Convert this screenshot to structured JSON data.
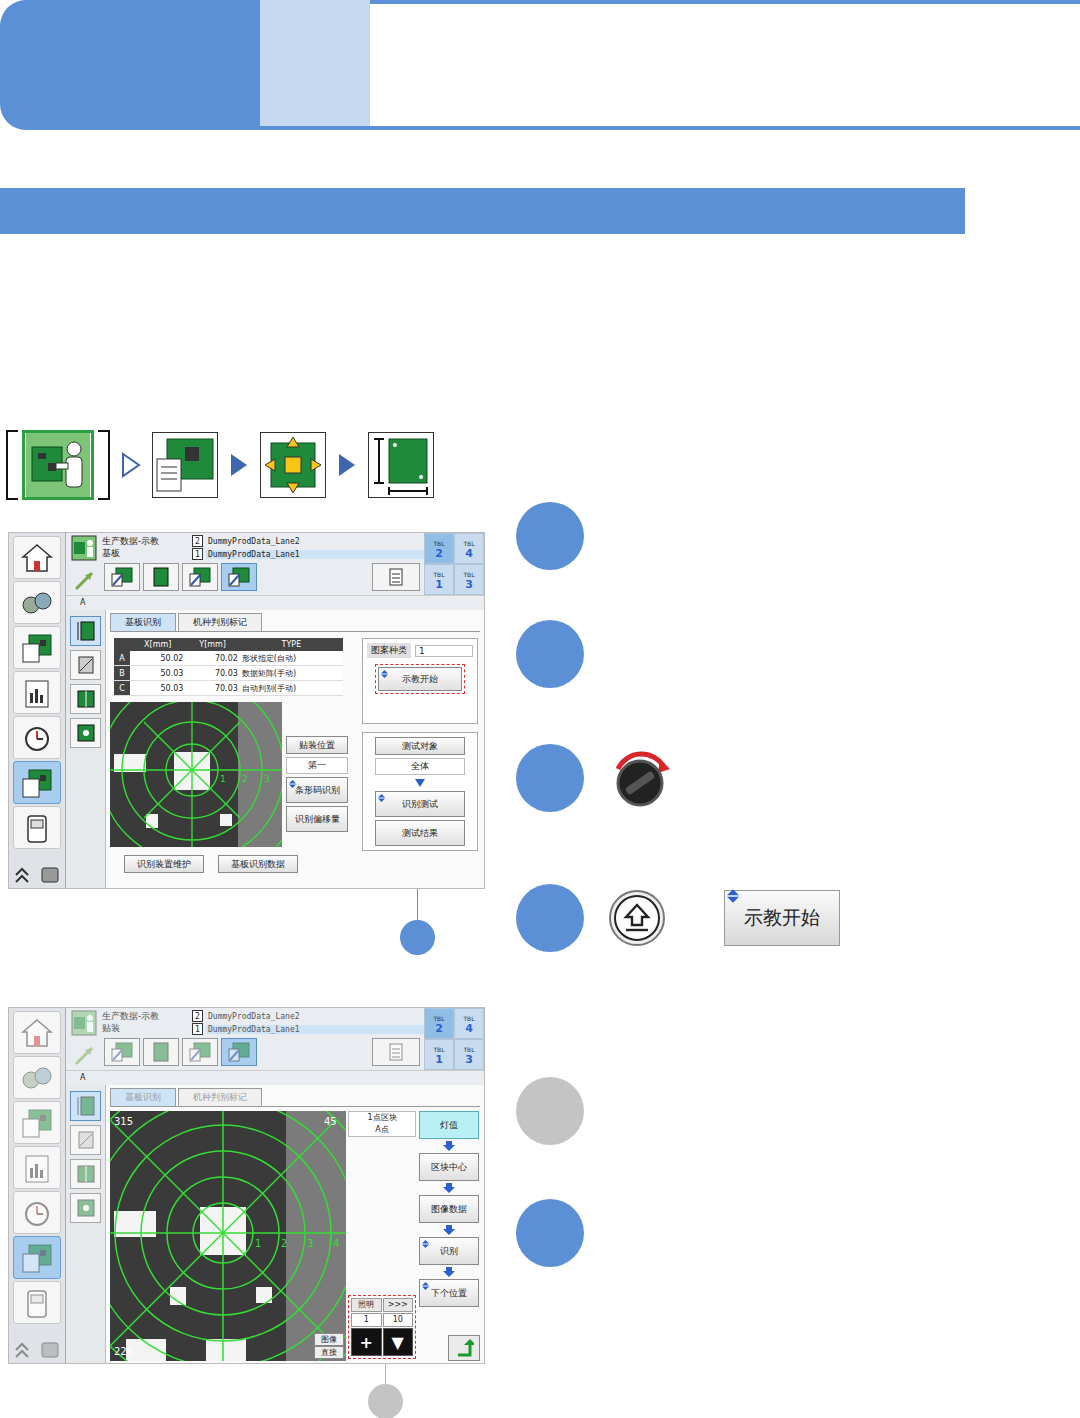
{
  "steps": [
    {
      "kind": "plain",
      "active": true
    },
    {
      "kind": "plain",
      "active": true
    },
    {
      "kind": "knob",
      "active": true
    },
    {
      "kind": "button",
      "active": true,
      "button_label": "示教开始"
    },
    {
      "kind": "plain",
      "active": false
    },
    {
      "kind": "plain",
      "active": true
    }
  ],
  "screens": [
    {
      "kind": "board",
      "dimmed": false,
      "title": "生产数据-示教",
      "subtitle": "基板",
      "lanes": [
        {
          "num": "2",
          "name": "DummyProdData_Lane2",
          "selected": false
        },
        {
          "num": "1",
          "name": "DummyProdData_Lane1",
          "selected": true
        }
      ],
      "tbl": [
        {
          "label": "TBL",
          "num": "2",
          "selected": true
        },
        {
          "label": "TBL",
          "num": "4",
          "selected": false
        },
        {
          "label": "TBL",
          "num": "1",
          "selected": false
        },
        {
          "label": "TBL",
          "num": "3",
          "selected": false
        }
      ],
      "sidebar": [
        {
          "selected": false
        },
        {
          "selected": false
        },
        {
          "selected": false
        },
        {
          "selected": false
        },
        {
          "selected": false
        },
        {
          "selected": true
        },
        {
          "selected": false
        }
      ],
      "toolbar": [
        {
          "selected": false
        },
        {
          "selected": false
        },
        {
          "selected": false
        },
        {
          "selected": true
        }
      ],
      "subside": [
        {
          "selected": true
        },
        {
          "selected": false
        },
        {
          "selected": false
        },
        {
          "selected": false
        }
      ],
      "head_label": "A",
      "tabs": [
        {
          "label": "基板识别",
          "selected": true
        },
        {
          "label": "机种判别标记",
          "selected": false
        }
      ],
      "table": {
        "columns": [
          "X[mm]",
          "Y[mm]",
          "TYPE"
        ],
        "rows": [
          {
            "id": "A",
            "x": "50.02",
            "y": "70.02",
            "type": "形状指定(自动)"
          },
          {
            "id": "B",
            "x": "50.03",
            "y": "70.03",
            "type": "数据矩阵(手动)"
          },
          {
            "id": "C",
            "x": "50.03",
            "y": "70.03",
            "type": "自动判别(手动)"
          }
        ]
      },
      "pattern": {
        "label": "图案种类",
        "value": "1"
      },
      "teach_button": "示教开始",
      "test_target": {
        "label": "测试对象",
        "value": "全体"
      },
      "test_buttons": [
        "识别测试",
        "测试结果"
      ],
      "mount": {
        "label": "贴装位置",
        "value": "第一"
      },
      "side_buttons": [
        "条形码识别",
        "识别偏移量"
      ],
      "bottom_buttons": [
        "识别装置维护",
        "基板识别数据"
      ],
      "rings": [
        "1",
        "2",
        "3"
      ],
      "callout_active": true
    },
    {
      "kind": "teach",
      "dimmed": true,
      "title": "生产数据-示教",
      "subtitle": "贴装",
      "lanes": [
        {
          "num": "2",
          "name": "DummyProdData_Lane2",
          "selected": false
        },
        {
          "num": "1",
          "name": "DummyProdData_Lane1",
          "selected": true
        }
      ],
      "tbl": [
        {
          "label": "TBL",
          "num": "2",
          "selected": true
        },
        {
          "label": "TBL",
          "num": "4",
          "selected": false
        },
        {
          "label": "TBL",
          "num": "1",
          "selected": false
        },
        {
          "label": "TBL",
          "num": "3",
          "selected": false
        }
      ],
      "sidebar": [
        {
          "selected": false
        },
        {
          "selected": false
        },
        {
          "selected": false
        },
        {
          "selected": false
        },
        {
          "selected": false
        },
        {
          "selected": true
        },
        {
          "selected": false
        }
      ],
      "toolbar": [
        {
          "selected": false
        },
        {
          "selected": false
        },
        {
          "selected": false
        },
        {
          "selected": true
        }
      ],
      "subside": [
        {
          "selected": true
        },
        {
          "selected": false
        },
        {
          "selected": false
        },
        {
          "selected": false
        }
      ],
      "head_label": "A",
      "tabs": [
        {
          "label": "基板识别",
          "selected": true
        },
        {
          "label": "机种判别标记",
          "selected": false
        }
      ],
      "block": {
        "title": "1点区块",
        "point": "A点"
      },
      "flow": [
        {
          "label": "灯值",
          "selected": true
        },
        {
          "label": "区块中心",
          "selected": false
        },
        {
          "label": "图像数据",
          "selected": false
        },
        {
          "label": "识别",
          "selected": false
        },
        {
          "label": "下个位置",
          "selected": false
        }
      ],
      "light": {
        "label": "照明",
        "more": ">>>",
        "value": "1",
        "step": "10",
        "buttons": [
          "+",
          "▼"
        ]
      },
      "image_buttons": [
        "图像",
        "直接"
      ],
      "angles": [
        "315",
        "45",
        "225"
      ],
      "rings": [
        "1",
        "2",
        "3",
        "4"
      ],
      "callout_active": false
    }
  ]
}
